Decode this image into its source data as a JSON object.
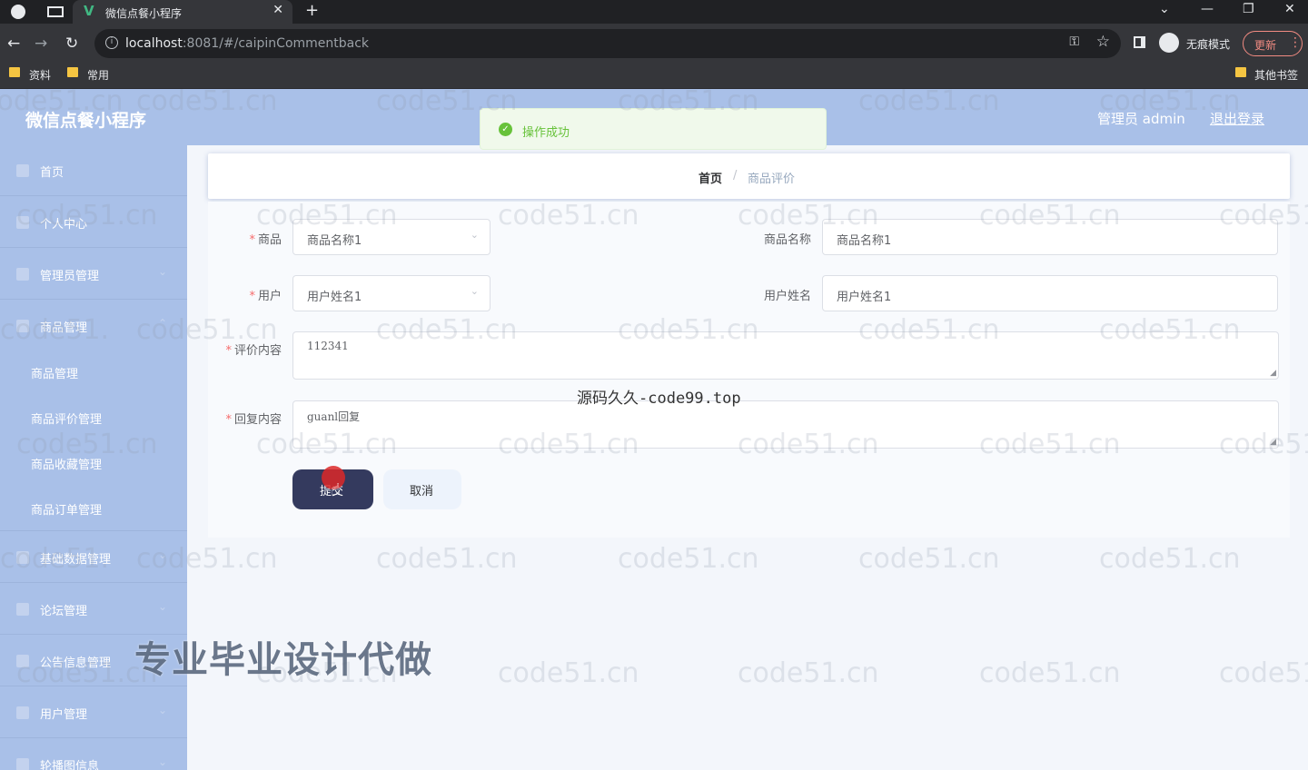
{
  "browser": {
    "tab_title": "微信点餐小程序",
    "tab_icon": "vue-icon",
    "url_host": "localhost",
    "url_path": ":8081/#/caipinCommentback",
    "incognito_label": "无痕模式",
    "update_label": "更新",
    "bookmarks": [
      "资料",
      "常用"
    ],
    "other_bookmarks": "其他书签"
  },
  "header": {
    "app_title": "微信点餐小程序",
    "admin_label": "管理员 admin",
    "logout_label": "退出登录"
  },
  "toast": {
    "message": "操作成功",
    "color": "#67c23a"
  },
  "sidebar": {
    "items": [
      {
        "label": "首页",
        "icon": "home-icon"
      },
      {
        "label": "个人中心",
        "icon": "user-icon"
      },
      {
        "label": "管理员管理",
        "icon": "bar-chart-icon"
      },
      {
        "label": "商品管理",
        "icon": "goods-icon"
      }
    ],
    "sub_items": [
      "商品管理",
      "商品评价管理",
      "商品收藏管理",
      "商品订单管理"
    ],
    "items_after": [
      {
        "label": "基础数据管理",
        "icon": "data-icon"
      },
      {
        "label": "论坛管理",
        "icon": "forum-icon"
      },
      {
        "label": "公告信息管理",
        "icon": "notice-icon"
      },
      {
        "label": "用户管理",
        "icon": "users-icon"
      },
      {
        "label": "轮播图信息",
        "icon": "carousel-icon"
      }
    ]
  },
  "breadcrumb": {
    "home": "首页",
    "separator": "/",
    "current": "商品评价"
  },
  "form": {
    "goods": {
      "label": "商品",
      "value": "商品名称1"
    },
    "goods_name": {
      "label": "商品名称",
      "value": "商品名称1"
    },
    "user": {
      "label": "用户",
      "value": "用户姓名1"
    },
    "user_name": {
      "label": "用户姓名",
      "value": "用户姓名1"
    },
    "comment": {
      "label": "评价内容",
      "value": "112341"
    },
    "reply": {
      "label": "回复内容",
      "value": "guanl回复"
    },
    "submit_label": "提交",
    "cancel_label": "取消"
  },
  "watermarks": {
    "repeat_text": "code51.cn",
    "center_text": "源码久久-code99.top",
    "banner_text": "专业毕业设计代做"
  },
  "colors": {
    "sidebar_bg": "#a9c0e8",
    "submit_bg": "#343a5e"
  }
}
